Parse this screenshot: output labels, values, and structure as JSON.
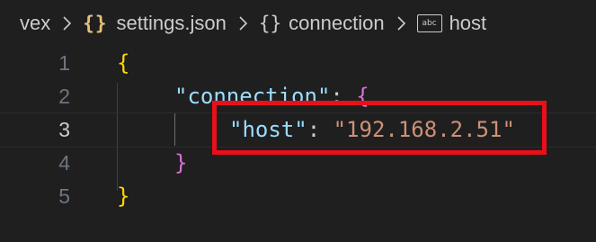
{
  "breadcrumb": {
    "items": [
      {
        "label": "vex",
        "icon": ""
      },
      {
        "label": "settings.json",
        "icon": "json-braces-icon",
        "icon_glyph": "{}"
      },
      {
        "label": "connection",
        "icon": "object-braces-icon",
        "icon_glyph": "{}"
      },
      {
        "label": "host",
        "icon": "string-abc-icon",
        "icon_glyph": "abc"
      }
    ]
  },
  "editor": {
    "lines": [
      {
        "number": "1",
        "brace_open": "{"
      },
      {
        "number": "2",
        "key": "\"connection\"",
        "colon": ": ",
        "brace_open": "{"
      },
      {
        "number": "3",
        "key": "\"host\"",
        "colon": ": ",
        "value": "\"192.168.2.51\""
      },
      {
        "number": "4",
        "brace_close": "}"
      },
      {
        "number": "5",
        "brace_close": "}"
      }
    ],
    "active_line": "3"
  },
  "colors": {
    "background": "#1f1f1f",
    "key": "#9cdcfe",
    "string": "#ce9178",
    "brace_level1": "#ffd700",
    "brace_level2": "#da70d6",
    "highlight_box": "#e8101a"
  }
}
